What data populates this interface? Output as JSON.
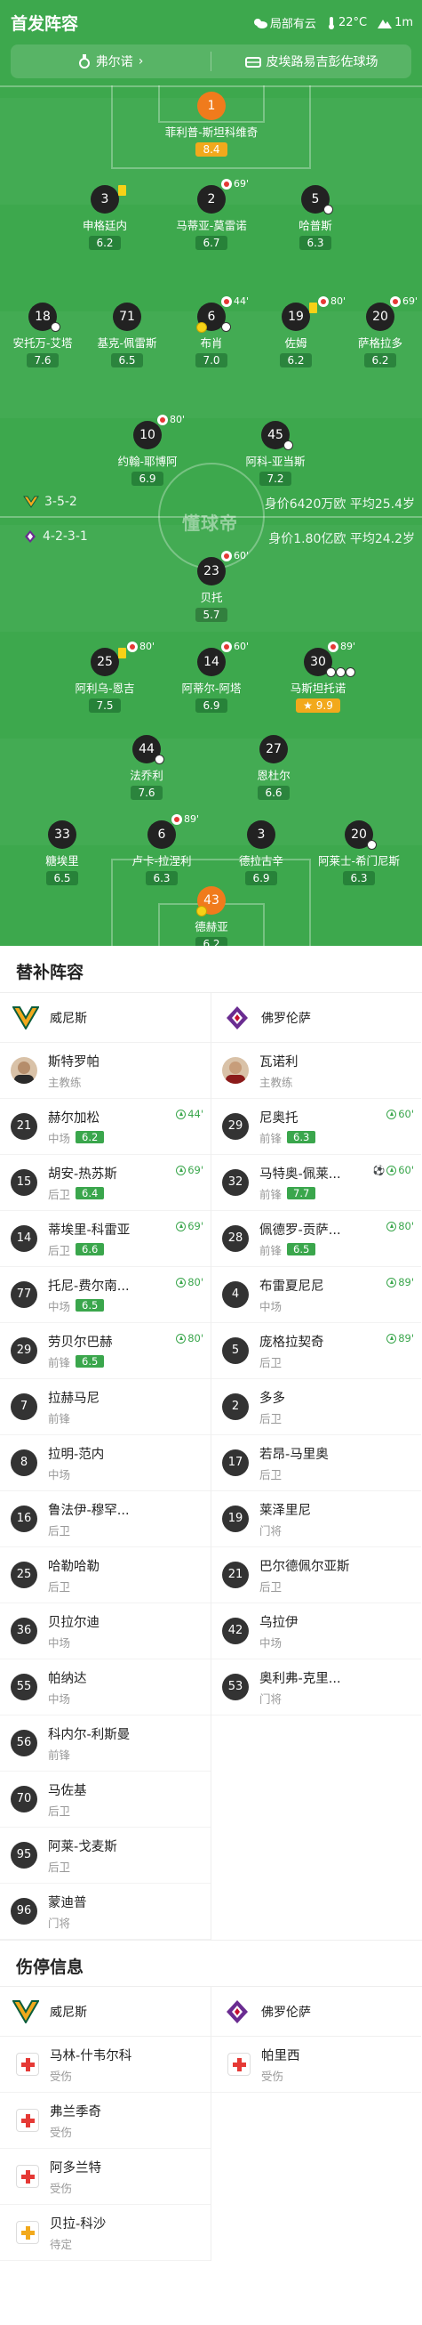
{
  "header": {
    "title": "首发阵容",
    "weather": "局部有云",
    "temp": "22°C",
    "wind": "1m"
  },
  "info": {
    "referee": "弗尔诺",
    "venue": "皮埃路易吉彭佐球场"
  },
  "home": {
    "formation": "3-5-2",
    "value": "身价6420万欧 平均25.4岁"
  },
  "away": {
    "formation": "4-2-3-1",
    "value": "身价1.80亿欧 平均24.2岁"
  },
  "watermark": "懂球帝",
  "players": [
    {
      "num": "1",
      "name": "菲利普-斯坦科维奇",
      "rating": "8.4",
      "hi": true,
      "gk": true
    },
    {
      "num": "3",
      "name": "申格廷内",
      "rating": "6.2"
    },
    {
      "num": "2",
      "name": "马蒂亚-莫雷诺",
      "rating": "6.7",
      "sub": "69'"
    },
    {
      "num": "5",
      "name": "哈普斯",
      "rating": "6.3"
    },
    {
      "num": "18",
      "name": "安托万-艾塔",
      "rating": "7.6"
    },
    {
      "num": "71",
      "name": "基克-佩雷斯",
      "rating": "6.5"
    },
    {
      "num": "6",
      "name": "布肖",
      "rating": "7.0",
      "sub": "44'"
    },
    {
      "num": "19",
      "name": "佐姆",
      "rating": "6.2",
      "sub": "80'"
    },
    {
      "num": "20",
      "name": "萨格拉多",
      "rating": "6.2",
      "sub": "69'"
    },
    {
      "num": "10",
      "name": "约翰-耶博阿",
      "rating": "6.9",
      "sub": "80'"
    },
    {
      "num": "45",
      "name": "阿科-亚当斯",
      "rating": "7.2"
    },
    {
      "num": "23",
      "name": "贝托",
      "rating": "5.7",
      "sub": "60'"
    },
    {
      "num": "25",
      "name": "阿利乌-恩吉",
      "rating": "7.5",
      "sub": "80'"
    },
    {
      "num": "14",
      "name": "阿蒂尔-阿塔",
      "rating": "6.9",
      "sub": "60'"
    },
    {
      "num": "30",
      "name": "马斯坦托诺",
      "rating": "9.9",
      "sub": "89'",
      "hi": true,
      "mvp": "★"
    },
    {
      "num": "44",
      "name": "法乔利",
      "rating": "7.6"
    },
    {
      "num": "27",
      "name": "恩杜尔",
      "rating": "6.6"
    },
    {
      "num": "33",
      "name": "糖埃里",
      "rating": "6.5"
    },
    {
      "num": "6",
      "name": "卢卡-拉涅利",
      "rating": "6.3",
      "sub": "89'"
    },
    {
      "num": "3",
      "name": "德拉古辛",
      "rating": "6.9"
    },
    {
      "num": "20",
      "name": "阿莱士-希门尼斯",
      "rating": "6.3"
    },
    {
      "num": "43",
      "name": "德赫亚",
      "rating": "6.2",
      "gk": true
    }
  ],
  "subs": {
    "title": "替补阵容",
    "home_team": "威尼斯",
    "away_team": "佛罗伦萨",
    "coach_label": "主教练",
    "home_coach": "斯特罗帕",
    "away_coach": "瓦诺利",
    "home": [
      {
        "num": "21",
        "name": "赫尔加松",
        "pos": "中场",
        "rating": "6.2",
        "in": "44'"
      },
      {
        "num": "15",
        "name": "胡安-热苏斯",
        "pos": "后卫",
        "rating": "6.4",
        "in": "69'"
      },
      {
        "num": "14",
        "name": "蒂埃里-科雷亚",
        "pos": "后卫",
        "rating": "6.6",
        "in": "69'"
      },
      {
        "num": "77",
        "name": "托尼-费尔南...",
        "pos": "中场",
        "rating": "6.5",
        "in": "80'"
      },
      {
        "num": "29",
        "name": "劳贝尔巴赫",
        "pos": "前锋",
        "rating": "6.5",
        "in": "80'"
      },
      {
        "num": "7",
        "name": "拉赫马尼",
        "pos": "前锋"
      },
      {
        "num": "8",
        "name": "拉明-范内",
        "pos": "中场"
      },
      {
        "num": "16",
        "name": "鲁法伊-穆罕...",
        "pos": "后卫"
      },
      {
        "num": "25",
        "name": "哈勒哈勒",
        "pos": "后卫"
      },
      {
        "num": "36",
        "name": "贝拉尔迪",
        "pos": "中场"
      },
      {
        "num": "55",
        "name": "帕纳达",
        "pos": "中场"
      },
      {
        "num": "56",
        "name": "科内尔-利斯曼",
        "pos": "前锋"
      },
      {
        "num": "70",
        "name": "马佐基",
        "pos": "后卫"
      },
      {
        "num": "95",
        "name": "阿莱-戈麦斯",
        "pos": "后卫"
      },
      {
        "num": "96",
        "name": "蒙迪普",
        "pos": "门将"
      }
    ],
    "away": [
      {
        "num": "29",
        "name": "尼奥托",
        "pos": "前锋",
        "rating": "6.3",
        "in": "60'"
      },
      {
        "num": "32",
        "name": "马特奥-佩莱...",
        "pos": "前锋",
        "rating": "7.7",
        "in": "60'",
        "goals": true
      },
      {
        "num": "28",
        "name": "佩德罗-贡萨...",
        "pos": "前锋",
        "rating": "6.5",
        "in": "80'"
      },
      {
        "num": "4",
        "name": "布雷夏尼尼",
        "pos": "中场",
        "in": "89'"
      },
      {
        "num": "5",
        "name": "庞格拉契奇",
        "pos": "后卫",
        "in": "89'"
      },
      {
        "num": "2",
        "name": "多多",
        "pos": "后卫"
      },
      {
        "num": "17",
        "name": "若昂-马里奥",
        "pos": "后卫"
      },
      {
        "num": "19",
        "name": "莱泽里尼",
        "pos": "门将"
      },
      {
        "num": "21",
        "name": "巴尔德佩尔亚斯",
        "pos": "后卫"
      },
      {
        "num": "42",
        "name": "乌拉伊",
        "pos": "中场"
      },
      {
        "num": "53",
        "name": "奥利弗-克里...",
        "pos": "门将"
      }
    ]
  },
  "injuries": {
    "title": "伤停信息",
    "home": [
      {
        "name": "马林-什韦尔科",
        "status": "受伤"
      },
      {
        "name": "弗兰季奇",
        "status": "受伤"
      },
      {
        "name": "阿多兰特",
        "status": "受伤"
      },
      {
        "name": "贝拉-科沙",
        "status": "待定",
        "warn": true
      }
    ],
    "away": [
      {
        "name": "帕里西",
        "status": "受伤"
      }
    ]
  }
}
